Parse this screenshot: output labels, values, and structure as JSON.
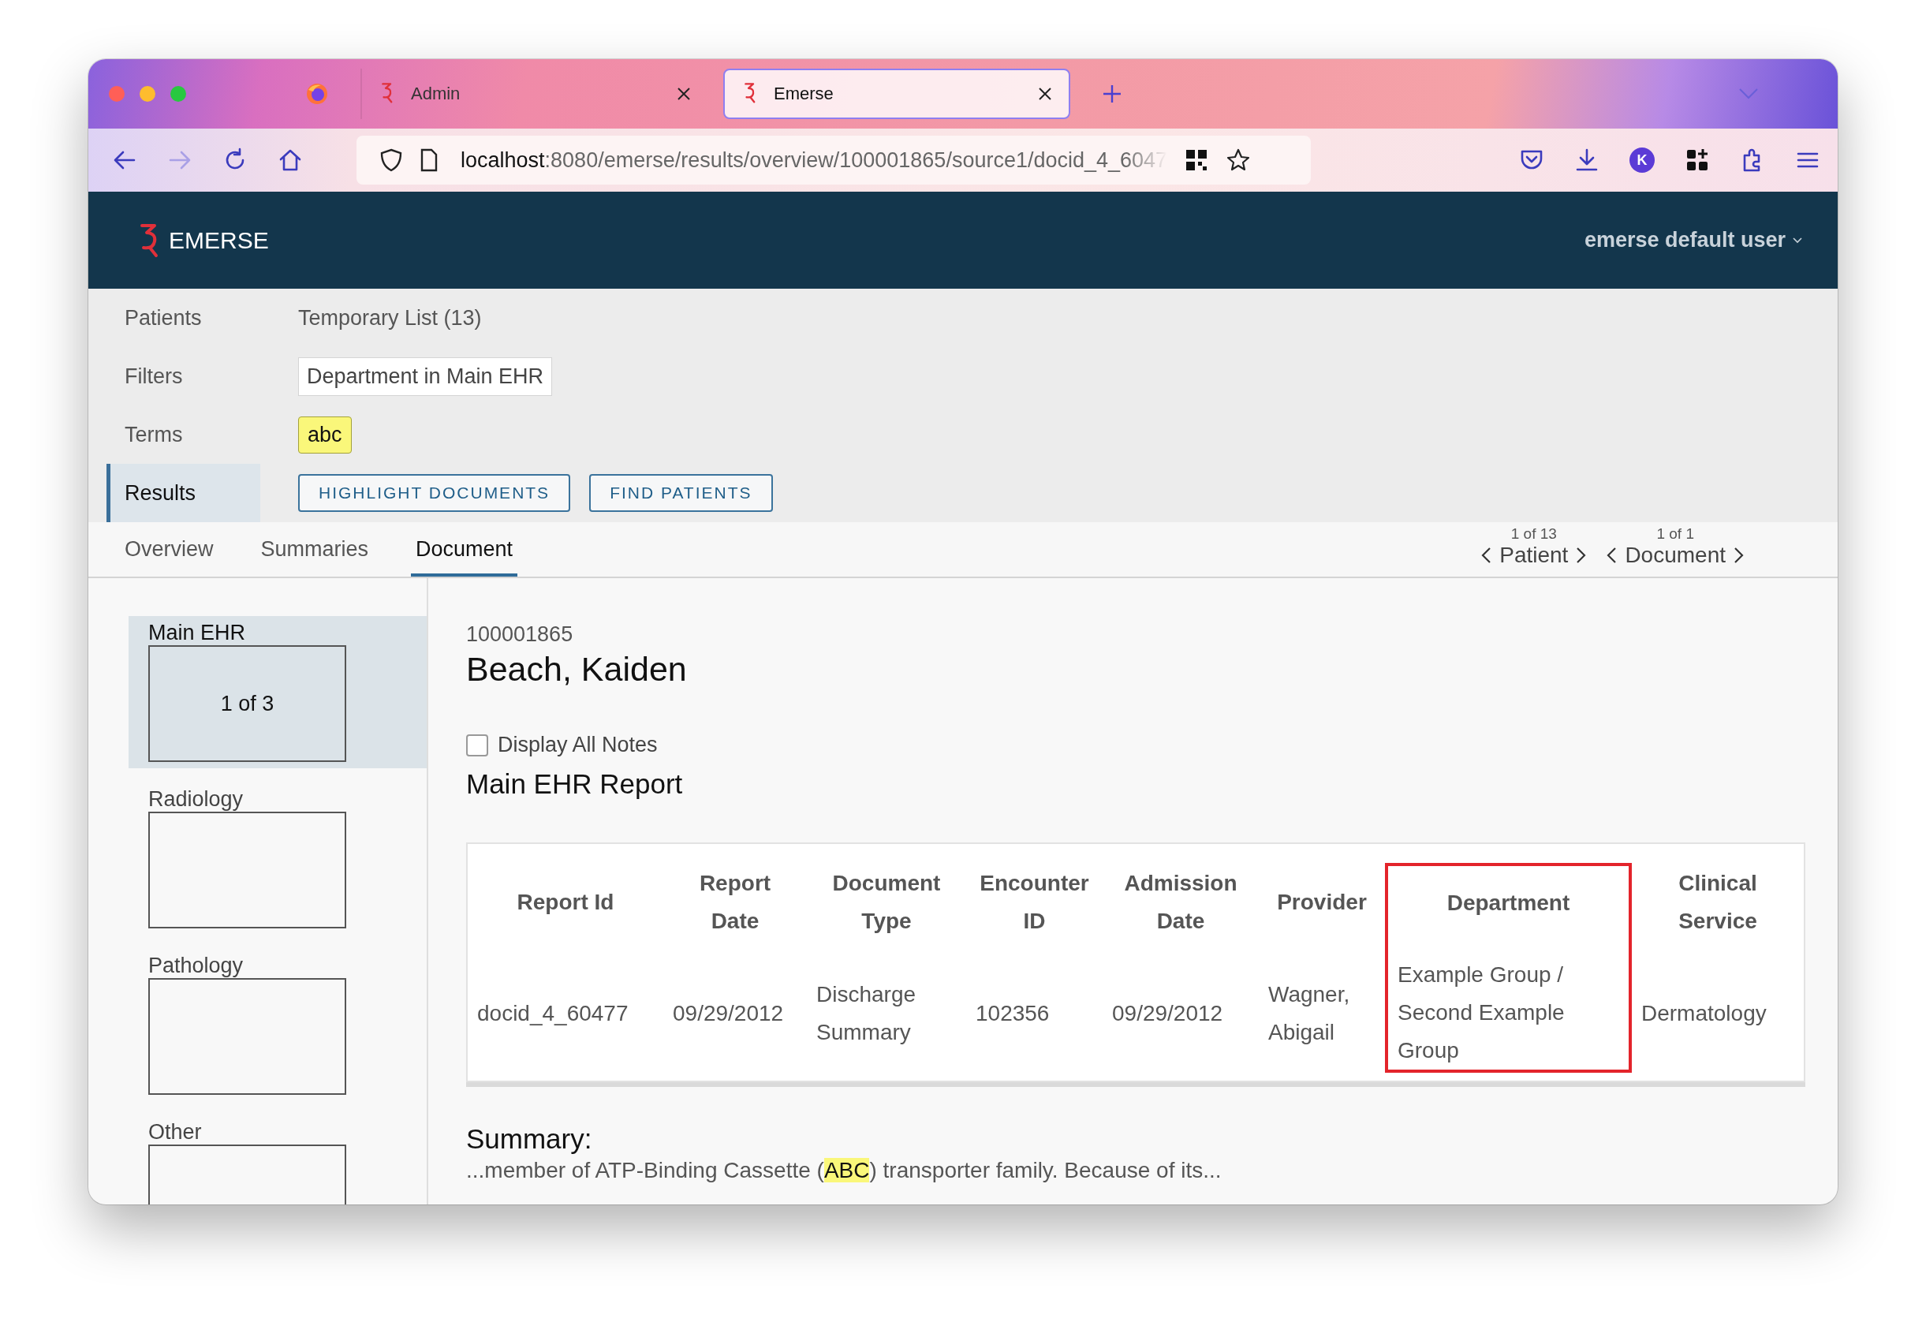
{
  "browser": {
    "tabs": [
      {
        "title": "Admin",
        "selected": false
      },
      {
        "title": "Emerse",
        "selected": true
      }
    ],
    "url": {
      "host": "localhost",
      "path": ":8080/emerse/results/overview/100001865/source1/docid_4_6047"
    },
    "avatar": "K"
  },
  "app": {
    "name": "EMERSE",
    "user": "emerse default user"
  },
  "query": [
    {
      "label": "Patients",
      "kind": "text",
      "value": "Temporary List (13)",
      "selected": false
    },
    {
      "label": "Filters",
      "kind": "chip",
      "value": "Department in Main EHR",
      "selected": false
    },
    {
      "label": "Terms",
      "kind": "term",
      "value": "abc",
      "selected": false
    },
    {
      "label": "Results",
      "kind": "buttons",
      "buttons": [
        "HIGHLIGHT DOCUMENTS",
        "FIND PATIENTS"
      ],
      "selected": true
    }
  ],
  "view_tabs": [
    {
      "label": "Overview",
      "selected": false
    },
    {
      "label": "Summaries",
      "selected": false
    },
    {
      "label": "Document",
      "selected": true
    }
  ],
  "pagers": [
    {
      "count": "1 of 13",
      "label": "Patient"
    },
    {
      "count": "1 of 1",
      "label": "Document"
    }
  ],
  "sources": [
    {
      "name": "Main EHR",
      "selected": true,
      "count": "1 of 3"
    },
    {
      "name": "Radiology",
      "selected": false
    },
    {
      "name": "Pathology",
      "selected": false
    },
    {
      "name": "Other",
      "selected": false
    }
  ],
  "document": {
    "patient_id": "100001865",
    "patient_name": "Beach, Kaiden",
    "display_all_notes": {
      "label": "Display All Notes",
      "checked": false
    },
    "report_title": "Main EHR Report",
    "table": {
      "columns": [
        {
          "label": "Report Id",
          "outlined": false
        },
        {
          "label": "Report Date",
          "outlined": false
        },
        {
          "label": "Document Type",
          "outlined": false
        },
        {
          "label": "Encounter ID",
          "outlined": false
        },
        {
          "label": "Admission Date",
          "outlined": false
        },
        {
          "label": "Provider",
          "outlined": false
        },
        {
          "label": "Department",
          "outlined": true
        },
        {
          "label": "Clinical Service",
          "outlined": false
        }
      ],
      "rows": [
        [
          "docid_4_60477",
          "09/29/2012",
          "Discharge Summary",
          "102356",
          "09/29/2012",
          "Wagner, Abigail",
          "Example Group / Second Example Group",
          "Dermatology"
        ]
      ]
    },
    "summary": {
      "label": "Summary:",
      "segments": [
        {
          "text": "...member of ATP-Binding Cassette (",
          "highlighted": false
        },
        {
          "text": "ABC",
          "highlighted": true
        },
        {
          "text": ") transporter family. Because of its...",
          "highlighted": false
        }
      ]
    }
  }
}
